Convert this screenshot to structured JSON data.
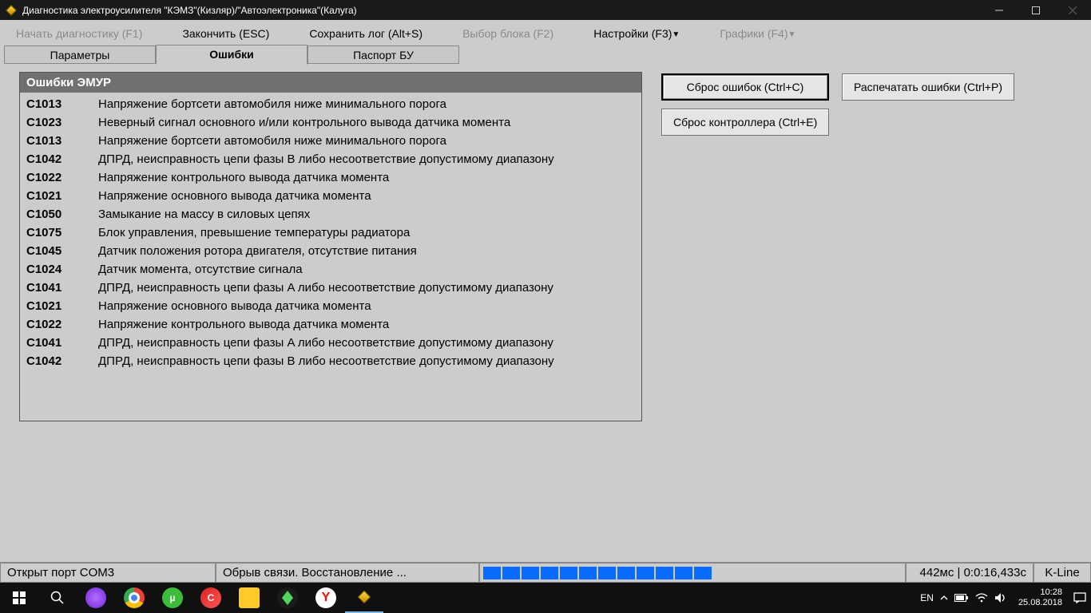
{
  "window": {
    "title": "Диагностика электроусилителя \"КЭМЗ\"(Кизляр)/\"Автоэлектроника\"(Калуга)"
  },
  "menu": {
    "start": "Начать диагностику (F1)",
    "finish": "Закончить (ESC)",
    "save_log": "Сохранить лог (Alt+S)",
    "block_select": "Выбор блока (F2)",
    "settings": "Настройки (F3)",
    "charts": "Графики (F4)"
  },
  "tabs": {
    "params": "Параметры",
    "errors": "Ошибки",
    "passport": "Паспорт БУ"
  },
  "errors_panel": {
    "header": "Ошибки ЭМУР",
    "rows": [
      {
        "code": "C1013",
        "desc": "Напряжение бортсети автомобиля ниже минимального порога"
      },
      {
        "code": "C1023",
        "desc": "Неверный сигнал основного и/или контрольного вывода датчика момента"
      },
      {
        "code": "C1013",
        "desc": "Напряжение бортсети автомобиля ниже минимального порога"
      },
      {
        "code": "C1042",
        "desc": "ДПРД, неисправность цепи фазы B либо несоответствие допустимому диапазону"
      },
      {
        "code": "C1022",
        "desc": "Напряжение контрольного вывода датчика момента"
      },
      {
        "code": "C1021",
        "desc": "Напряжение основного вывода датчика момента"
      },
      {
        "code": "C1050",
        "desc": "Замыкание на массу в силовых цепях"
      },
      {
        "code": "C1075",
        "desc": "Блок управления, превышение температуры радиатора"
      },
      {
        "code": "C1045",
        "desc": "Датчик положения ротора двигателя, отсутствие питания"
      },
      {
        "code": "C1024",
        "desc": "Датчик момента, отсутствие сигнала"
      },
      {
        "code": "C1041",
        "desc": "ДПРД, неисправность цепи фазы A либо несоответствие допустимому диапазону"
      },
      {
        "code": "C1021",
        "desc": "Напряжение основного вывода датчика момента"
      },
      {
        "code": "C1022",
        "desc": "Напряжение контрольного вывода датчика момента"
      },
      {
        "code": "C1041",
        "desc": "ДПРД, неисправность цепи фазы A либо несоответствие допустимому диапазону"
      },
      {
        "code": "C1042",
        "desc": "ДПРД, неисправность цепи фазы B либо несоответствие допустимому диапазону"
      }
    ]
  },
  "buttons": {
    "clear_errors": "Сброс ошибок (Ctrl+C)",
    "print_errors": "Распечатать ошибки (Ctrl+P)",
    "reset_controller": "Сброс контроллера (Ctrl+E)"
  },
  "statusbar": {
    "port": "Открыт порт COM3",
    "connection": "Обрыв связи. Восстановление ...",
    "progress_segments": 12,
    "timing": "442мс | 0:0:16,433с",
    "protocol": "K-Line"
  },
  "taskbar": {
    "lang": "EN",
    "time": "10:28",
    "date": "25.08.2018"
  }
}
